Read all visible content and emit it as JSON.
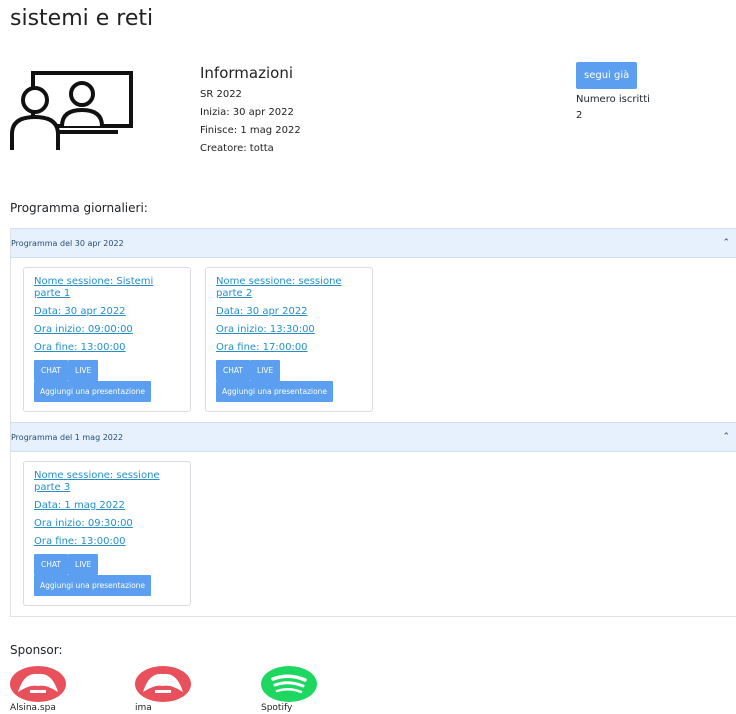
{
  "page": {
    "title": "sistemi e reti"
  },
  "info": {
    "heading": "Informazioni",
    "code": "SR 2022",
    "start": "Inizia: 30 apr 2022",
    "end": "Finisce: 1 mag 2022",
    "creator": "Creatore: totta"
  },
  "follow": {
    "button_label": "segui già",
    "subscribers_label": "Numero iscritti",
    "subscribers_count": "2"
  },
  "schedule": {
    "heading": "Programma giornalieri:",
    "days": [
      {
        "title": "Programma del 30 apr 2022",
        "sessions": [
          {
            "name": "Nome sessione: Sistemi parte 1",
            "date": "Data: 30 apr 2022",
            "start": "Ora inizio: 09:00:00",
            "end": "Ora fine: 13:00:00"
          },
          {
            "name": "Nome sessione: sessione parte 2",
            "date": "Data: 30 apr 2022",
            "start": "Ora inizio: 13:30:00",
            "end": "Ora fine: 17:00:00"
          }
        ]
      },
      {
        "title": "Programma del 1 mag 2022",
        "sessions": [
          {
            "name": "Nome sessione: sessione parte 3",
            "date": "Data: 1 mag 2022",
            "start": "Ora inizio: 09:30:00",
            "end": "Ora fine: 13:00:00"
          }
        ]
      }
    ]
  },
  "session_buttons": {
    "chat": "CHAT",
    "live": "LIVE",
    "add_presentation": "Aggiungi una presentazione"
  },
  "sponsors": {
    "heading": "Sponsor:",
    "items": [
      {
        "name": "Alsina.spa",
        "logo": "red-white-logo",
        "color": "#e8505b"
      },
      {
        "name": "ima",
        "logo": "red-white-logo",
        "color": "#e8505b"
      },
      {
        "name": "Spotify",
        "logo": "spotify-logo",
        "color": "#1ed760"
      }
    ]
  },
  "colors": {
    "accent": "#5c9ef0",
    "link": "#2490c9",
    "accordion_bg": "#e7f1fd"
  }
}
